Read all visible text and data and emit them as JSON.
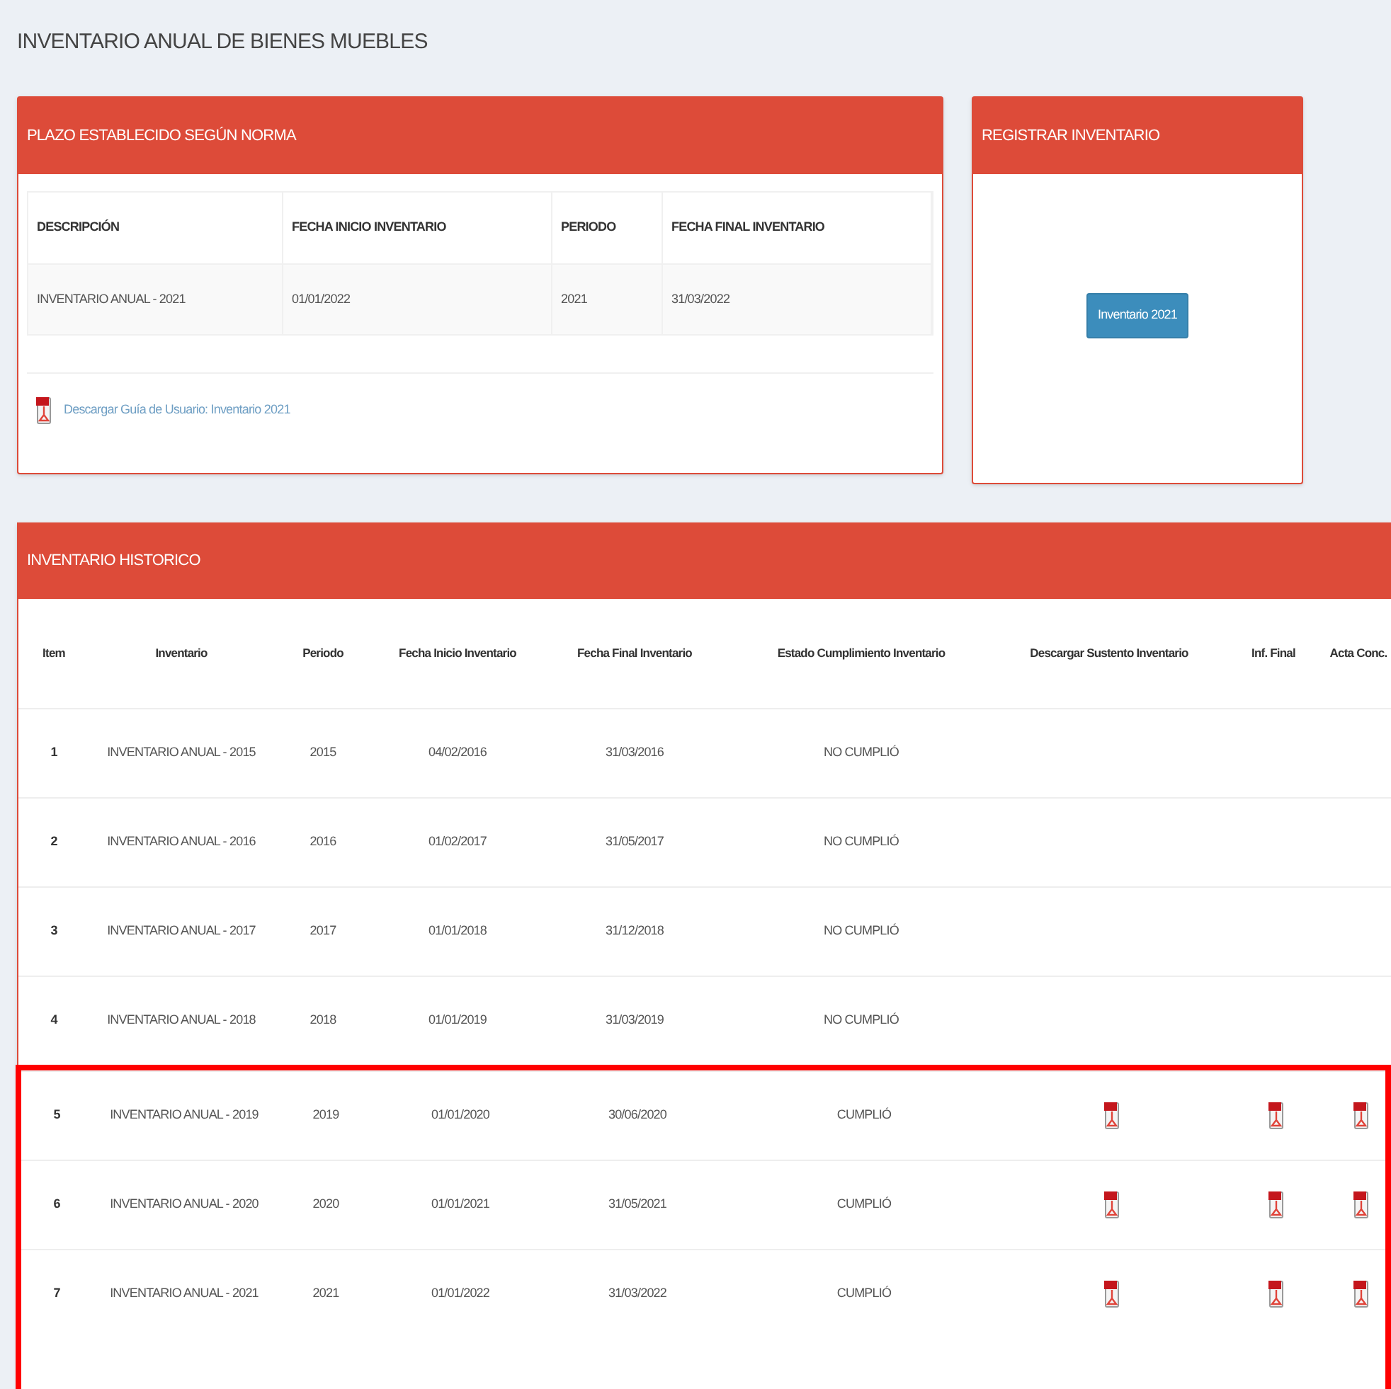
{
  "title": "INVENTARIO ANUAL DE BIENES MUEBLES",
  "deadline_panel": {
    "title": "PLAZO ESTABLECIDO SEGÚN NORMA",
    "columns": [
      "DESCRIPCIÓN",
      "FECHA INICIO INVENTARIO",
      "PERIODO",
      "FECHA FINAL INVENTARIO"
    ],
    "row": [
      "INVENTARIO ANUAL - 2021",
      "01/01/2022",
      "2021",
      "31/03/2022"
    ],
    "download_link": "Descargar Guía de Usuario: Inventario 2021"
  },
  "register_panel": {
    "title": "REGISTRAR INVENTARIO",
    "button": "Inventario 2021"
  },
  "history_panel": {
    "title": "INVENTARIO HISTORICO",
    "columns": [
      "Item",
      "Inventario",
      "Periodo",
      "Fecha Inicio Inventario",
      "Fecha Final Inventario",
      "Estado Cumplimiento Inventario",
      "Descargar Sustento Inventario",
      "Inf. Final",
      "Acta Conc."
    ],
    "rows": [
      {
        "cells": [
          "1",
          "INVENTARIO ANUAL - 2015",
          "2015",
          "04/02/2016",
          "31/03/2016",
          "NO CUMPLIÓ"
        ],
        "documents": [
          false,
          false,
          false
        ],
        "highlighted": false
      },
      {
        "cells": [
          "2",
          "INVENTARIO ANUAL - 2016",
          "2016",
          "01/02/2017",
          "31/05/2017",
          "NO CUMPLIÓ"
        ],
        "documents": [
          false,
          false,
          false
        ],
        "highlighted": false
      },
      {
        "cells": [
          "3",
          "INVENTARIO ANUAL - 2017",
          "2017",
          "01/01/2018",
          "31/12/2018",
          "NO CUMPLIÓ"
        ],
        "documents": [
          false,
          false,
          false
        ],
        "highlighted": false
      },
      {
        "cells": [
          "4",
          "INVENTARIO ANUAL - 2018",
          "2018",
          "01/01/2019",
          "31/03/2019",
          "NO CUMPLIÓ"
        ],
        "documents": [
          false,
          false,
          false
        ],
        "highlighted": false
      },
      {
        "cells": [
          "5",
          "INVENTARIO ANUAL - 2019",
          "2019",
          "01/01/2020",
          "30/06/2020",
          "CUMPLIÓ"
        ],
        "documents": [
          true,
          true,
          true
        ],
        "highlighted": true
      },
      {
        "cells": [
          "6",
          "INVENTARIO ANUAL - 2020",
          "2020",
          "01/01/2021",
          "31/05/2021",
          "CUMPLIÓ"
        ],
        "documents": [
          true,
          true,
          true
        ],
        "highlighted": true
      },
      {
        "cells": [
          "7",
          "INVENTARIO ANUAL - 2021",
          "2021",
          "01/01/2022",
          "31/03/2022",
          "CUMPLIÓ"
        ],
        "documents": [
          true,
          true,
          true
        ],
        "highlighted": true
      }
    ]
  }
}
